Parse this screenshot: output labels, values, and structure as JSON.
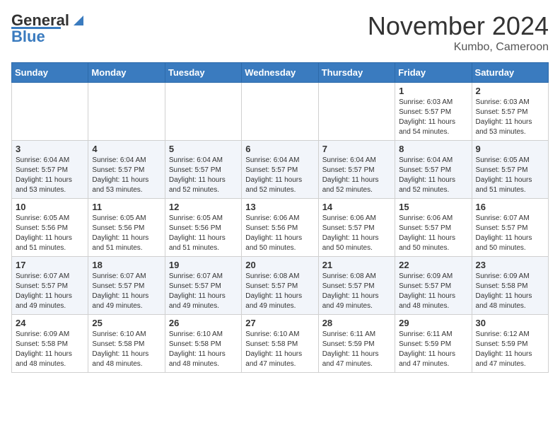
{
  "header": {
    "logo_line1": "General",
    "logo_line2": "Blue",
    "month": "November 2024",
    "location": "Kumbo, Cameroon"
  },
  "days_of_week": [
    "Sunday",
    "Monday",
    "Tuesday",
    "Wednesday",
    "Thursday",
    "Friday",
    "Saturday"
  ],
  "weeks": [
    [
      {
        "day": "",
        "sunrise": "",
        "sunset": "",
        "daylight": ""
      },
      {
        "day": "",
        "sunrise": "",
        "sunset": "",
        "daylight": ""
      },
      {
        "day": "",
        "sunrise": "",
        "sunset": "",
        "daylight": ""
      },
      {
        "day": "",
        "sunrise": "",
        "sunset": "",
        "daylight": ""
      },
      {
        "day": "",
        "sunrise": "",
        "sunset": "",
        "daylight": ""
      },
      {
        "day": "1",
        "sunrise": "Sunrise: 6:03 AM",
        "sunset": "Sunset: 5:57 PM",
        "daylight": "Daylight: 11 hours and 54 minutes."
      },
      {
        "day": "2",
        "sunrise": "Sunrise: 6:03 AM",
        "sunset": "Sunset: 5:57 PM",
        "daylight": "Daylight: 11 hours and 53 minutes."
      }
    ],
    [
      {
        "day": "3",
        "sunrise": "Sunrise: 6:04 AM",
        "sunset": "Sunset: 5:57 PM",
        "daylight": "Daylight: 11 hours and 53 minutes."
      },
      {
        "day": "4",
        "sunrise": "Sunrise: 6:04 AM",
        "sunset": "Sunset: 5:57 PM",
        "daylight": "Daylight: 11 hours and 53 minutes."
      },
      {
        "day": "5",
        "sunrise": "Sunrise: 6:04 AM",
        "sunset": "Sunset: 5:57 PM",
        "daylight": "Daylight: 11 hours and 52 minutes."
      },
      {
        "day": "6",
        "sunrise": "Sunrise: 6:04 AM",
        "sunset": "Sunset: 5:57 PM",
        "daylight": "Daylight: 11 hours and 52 minutes."
      },
      {
        "day": "7",
        "sunrise": "Sunrise: 6:04 AM",
        "sunset": "Sunset: 5:57 PM",
        "daylight": "Daylight: 11 hours and 52 minutes."
      },
      {
        "day": "8",
        "sunrise": "Sunrise: 6:04 AM",
        "sunset": "Sunset: 5:57 PM",
        "daylight": "Daylight: 11 hours and 52 minutes."
      },
      {
        "day": "9",
        "sunrise": "Sunrise: 6:05 AM",
        "sunset": "Sunset: 5:57 PM",
        "daylight": "Daylight: 11 hours and 51 minutes."
      }
    ],
    [
      {
        "day": "10",
        "sunrise": "Sunrise: 6:05 AM",
        "sunset": "Sunset: 5:56 PM",
        "daylight": "Daylight: 11 hours and 51 minutes."
      },
      {
        "day": "11",
        "sunrise": "Sunrise: 6:05 AM",
        "sunset": "Sunset: 5:56 PM",
        "daylight": "Daylight: 11 hours and 51 minutes."
      },
      {
        "day": "12",
        "sunrise": "Sunrise: 6:05 AM",
        "sunset": "Sunset: 5:56 PM",
        "daylight": "Daylight: 11 hours and 51 minutes."
      },
      {
        "day": "13",
        "sunrise": "Sunrise: 6:06 AM",
        "sunset": "Sunset: 5:56 PM",
        "daylight": "Daylight: 11 hours and 50 minutes."
      },
      {
        "day": "14",
        "sunrise": "Sunrise: 6:06 AM",
        "sunset": "Sunset: 5:57 PM",
        "daylight": "Daylight: 11 hours and 50 minutes."
      },
      {
        "day": "15",
        "sunrise": "Sunrise: 6:06 AM",
        "sunset": "Sunset: 5:57 PM",
        "daylight": "Daylight: 11 hours and 50 minutes."
      },
      {
        "day": "16",
        "sunrise": "Sunrise: 6:07 AM",
        "sunset": "Sunset: 5:57 PM",
        "daylight": "Daylight: 11 hours and 50 minutes."
      }
    ],
    [
      {
        "day": "17",
        "sunrise": "Sunrise: 6:07 AM",
        "sunset": "Sunset: 5:57 PM",
        "daylight": "Daylight: 11 hours and 49 minutes."
      },
      {
        "day": "18",
        "sunrise": "Sunrise: 6:07 AM",
        "sunset": "Sunset: 5:57 PM",
        "daylight": "Daylight: 11 hours and 49 minutes."
      },
      {
        "day": "19",
        "sunrise": "Sunrise: 6:07 AM",
        "sunset": "Sunset: 5:57 PM",
        "daylight": "Daylight: 11 hours and 49 minutes."
      },
      {
        "day": "20",
        "sunrise": "Sunrise: 6:08 AM",
        "sunset": "Sunset: 5:57 PM",
        "daylight": "Daylight: 11 hours and 49 minutes."
      },
      {
        "day": "21",
        "sunrise": "Sunrise: 6:08 AM",
        "sunset": "Sunset: 5:57 PM",
        "daylight": "Daylight: 11 hours and 49 minutes."
      },
      {
        "day": "22",
        "sunrise": "Sunrise: 6:09 AM",
        "sunset": "Sunset: 5:57 PM",
        "daylight": "Daylight: 11 hours and 48 minutes."
      },
      {
        "day": "23",
        "sunrise": "Sunrise: 6:09 AM",
        "sunset": "Sunset: 5:58 PM",
        "daylight": "Daylight: 11 hours and 48 minutes."
      }
    ],
    [
      {
        "day": "24",
        "sunrise": "Sunrise: 6:09 AM",
        "sunset": "Sunset: 5:58 PM",
        "daylight": "Daylight: 11 hours and 48 minutes."
      },
      {
        "day": "25",
        "sunrise": "Sunrise: 6:10 AM",
        "sunset": "Sunset: 5:58 PM",
        "daylight": "Daylight: 11 hours and 48 minutes."
      },
      {
        "day": "26",
        "sunrise": "Sunrise: 6:10 AM",
        "sunset": "Sunset: 5:58 PM",
        "daylight": "Daylight: 11 hours and 48 minutes."
      },
      {
        "day": "27",
        "sunrise": "Sunrise: 6:10 AM",
        "sunset": "Sunset: 5:58 PM",
        "daylight": "Daylight: 11 hours and 47 minutes."
      },
      {
        "day": "28",
        "sunrise": "Sunrise: 6:11 AM",
        "sunset": "Sunset: 5:59 PM",
        "daylight": "Daylight: 11 hours and 47 minutes."
      },
      {
        "day": "29",
        "sunrise": "Sunrise: 6:11 AM",
        "sunset": "Sunset: 5:59 PM",
        "daylight": "Daylight: 11 hours and 47 minutes."
      },
      {
        "day": "30",
        "sunrise": "Sunrise: 6:12 AM",
        "sunset": "Sunset: 5:59 PM",
        "daylight": "Daylight: 11 hours and 47 minutes."
      }
    ]
  ]
}
